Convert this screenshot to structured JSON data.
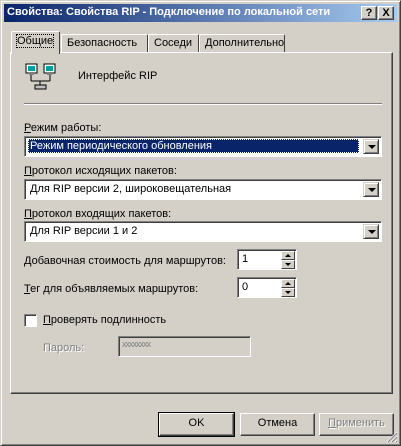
{
  "window": {
    "title": "Свойства: Свойства RIP - Подключение по локальной сети",
    "help_button": "?",
    "close_button": "X"
  },
  "tabs": [
    {
      "label": "Общие",
      "active": true
    },
    {
      "label": "Безопасность",
      "active": false
    },
    {
      "label": "Соседи",
      "active": false
    },
    {
      "label": "Дополнительно",
      "active": false
    }
  ],
  "general": {
    "interface_label": "Интерфейс RIP",
    "interface_icon": "network-interface-icon",
    "mode": {
      "label_underlined": "Р",
      "label_rest": "ежим работы:",
      "value": "Режим периодического обновления"
    },
    "outgoing": {
      "label_underlined": "П",
      "label_rest": "ротокол исходящих пакетов:",
      "value": "Для RIP версии 2, широковещательная"
    },
    "incoming": {
      "label_underlined": "П",
      "label_rest": "ротокол входящих пакетов:",
      "value": "Для RIP версии 1 и 2"
    },
    "added_cost": {
      "label_prefix": "",
      "label_underlined": "Д",
      "label_rest": "обавочная стоимость для маршрутов:",
      "value": "1"
    },
    "tag": {
      "label_underlined": "Т",
      "label_rest": "ег для объявляемых маршрутов:",
      "value": "0"
    },
    "verify": {
      "label_underlined": "П",
      "label_rest": "роверять подлинность",
      "checked": false
    },
    "password": {
      "label": "Пароль:",
      "value": "xxxxxxxx"
    }
  },
  "buttons": {
    "ok": "OK",
    "cancel": "Отмена",
    "apply_underlined": "П",
    "apply_rest": "рименить"
  },
  "colors": {
    "face": "#d4d0c8",
    "title_start": "#0a246a",
    "title_end": "#a6caf0",
    "selection": "#0a246a"
  }
}
